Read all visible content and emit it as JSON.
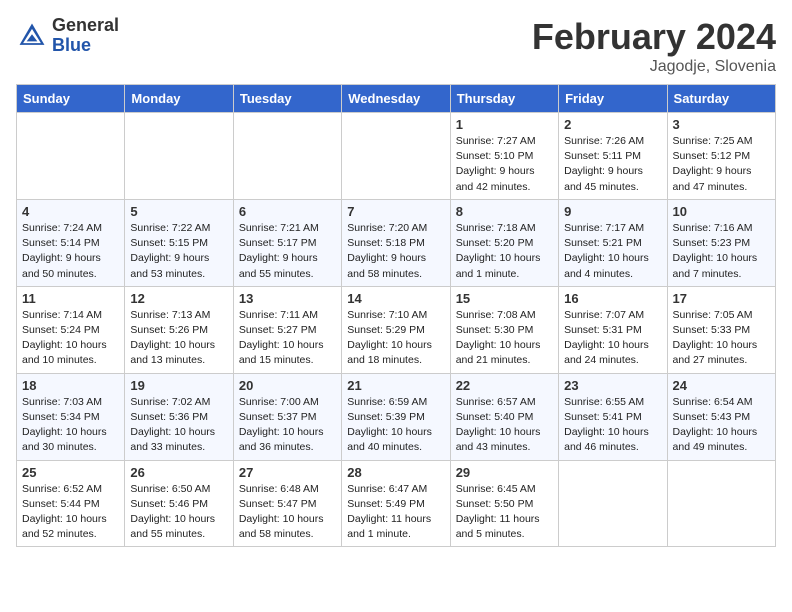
{
  "header": {
    "logo_general": "General",
    "logo_blue": "Blue",
    "month_year": "February 2024",
    "location": "Jagodje, Slovenia"
  },
  "weekdays": [
    "Sunday",
    "Monday",
    "Tuesday",
    "Wednesday",
    "Thursday",
    "Friday",
    "Saturday"
  ],
  "weeks": [
    [
      {
        "day": "",
        "info": ""
      },
      {
        "day": "",
        "info": ""
      },
      {
        "day": "",
        "info": ""
      },
      {
        "day": "",
        "info": ""
      },
      {
        "day": "1",
        "info": "Sunrise: 7:27 AM\nSunset: 5:10 PM\nDaylight: 9 hours\nand 42 minutes."
      },
      {
        "day": "2",
        "info": "Sunrise: 7:26 AM\nSunset: 5:11 PM\nDaylight: 9 hours\nand 45 minutes."
      },
      {
        "day": "3",
        "info": "Sunrise: 7:25 AM\nSunset: 5:12 PM\nDaylight: 9 hours\nand 47 minutes."
      }
    ],
    [
      {
        "day": "4",
        "info": "Sunrise: 7:24 AM\nSunset: 5:14 PM\nDaylight: 9 hours\nand 50 minutes."
      },
      {
        "day": "5",
        "info": "Sunrise: 7:22 AM\nSunset: 5:15 PM\nDaylight: 9 hours\nand 53 minutes."
      },
      {
        "day": "6",
        "info": "Sunrise: 7:21 AM\nSunset: 5:17 PM\nDaylight: 9 hours\nand 55 minutes."
      },
      {
        "day": "7",
        "info": "Sunrise: 7:20 AM\nSunset: 5:18 PM\nDaylight: 9 hours\nand 58 minutes."
      },
      {
        "day": "8",
        "info": "Sunrise: 7:18 AM\nSunset: 5:20 PM\nDaylight: 10 hours\nand 1 minute."
      },
      {
        "day": "9",
        "info": "Sunrise: 7:17 AM\nSunset: 5:21 PM\nDaylight: 10 hours\nand 4 minutes."
      },
      {
        "day": "10",
        "info": "Sunrise: 7:16 AM\nSunset: 5:23 PM\nDaylight: 10 hours\nand 7 minutes."
      }
    ],
    [
      {
        "day": "11",
        "info": "Sunrise: 7:14 AM\nSunset: 5:24 PM\nDaylight: 10 hours\nand 10 minutes."
      },
      {
        "day": "12",
        "info": "Sunrise: 7:13 AM\nSunset: 5:26 PM\nDaylight: 10 hours\nand 13 minutes."
      },
      {
        "day": "13",
        "info": "Sunrise: 7:11 AM\nSunset: 5:27 PM\nDaylight: 10 hours\nand 15 minutes."
      },
      {
        "day": "14",
        "info": "Sunrise: 7:10 AM\nSunset: 5:29 PM\nDaylight: 10 hours\nand 18 minutes."
      },
      {
        "day": "15",
        "info": "Sunrise: 7:08 AM\nSunset: 5:30 PM\nDaylight: 10 hours\nand 21 minutes."
      },
      {
        "day": "16",
        "info": "Sunrise: 7:07 AM\nSunset: 5:31 PM\nDaylight: 10 hours\nand 24 minutes."
      },
      {
        "day": "17",
        "info": "Sunrise: 7:05 AM\nSunset: 5:33 PM\nDaylight: 10 hours\nand 27 minutes."
      }
    ],
    [
      {
        "day": "18",
        "info": "Sunrise: 7:03 AM\nSunset: 5:34 PM\nDaylight: 10 hours\nand 30 minutes."
      },
      {
        "day": "19",
        "info": "Sunrise: 7:02 AM\nSunset: 5:36 PM\nDaylight: 10 hours\nand 33 minutes."
      },
      {
        "day": "20",
        "info": "Sunrise: 7:00 AM\nSunset: 5:37 PM\nDaylight: 10 hours\nand 36 minutes."
      },
      {
        "day": "21",
        "info": "Sunrise: 6:59 AM\nSunset: 5:39 PM\nDaylight: 10 hours\nand 40 minutes."
      },
      {
        "day": "22",
        "info": "Sunrise: 6:57 AM\nSunset: 5:40 PM\nDaylight: 10 hours\nand 43 minutes."
      },
      {
        "day": "23",
        "info": "Sunrise: 6:55 AM\nSunset: 5:41 PM\nDaylight: 10 hours\nand 46 minutes."
      },
      {
        "day": "24",
        "info": "Sunrise: 6:54 AM\nSunset: 5:43 PM\nDaylight: 10 hours\nand 49 minutes."
      }
    ],
    [
      {
        "day": "25",
        "info": "Sunrise: 6:52 AM\nSunset: 5:44 PM\nDaylight: 10 hours\nand 52 minutes."
      },
      {
        "day": "26",
        "info": "Sunrise: 6:50 AM\nSunset: 5:46 PM\nDaylight: 10 hours\nand 55 minutes."
      },
      {
        "day": "27",
        "info": "Sunrise: 6:48 AM\nSunset: 5:47 PM\nDaylight: 10 hours\nand 58 minutes."
      },
      {
        "day": "28",
        "info": "Sunrise: 6:47 AM\nSunset: 5:49 PM\nDaylight: 11 hours\nand 1 minute."
      },
      {
        "day": "29",
        "info": "Sunrise: 6:45 AM\nSunset: 5:50 PM\nDaylight: 11 hours\nand 5 minutes."
      },
      {
        "day": "",
        "info": ""
      },
      {
        "day": "",
        "info": ""
      }
    ]
  ]
}
